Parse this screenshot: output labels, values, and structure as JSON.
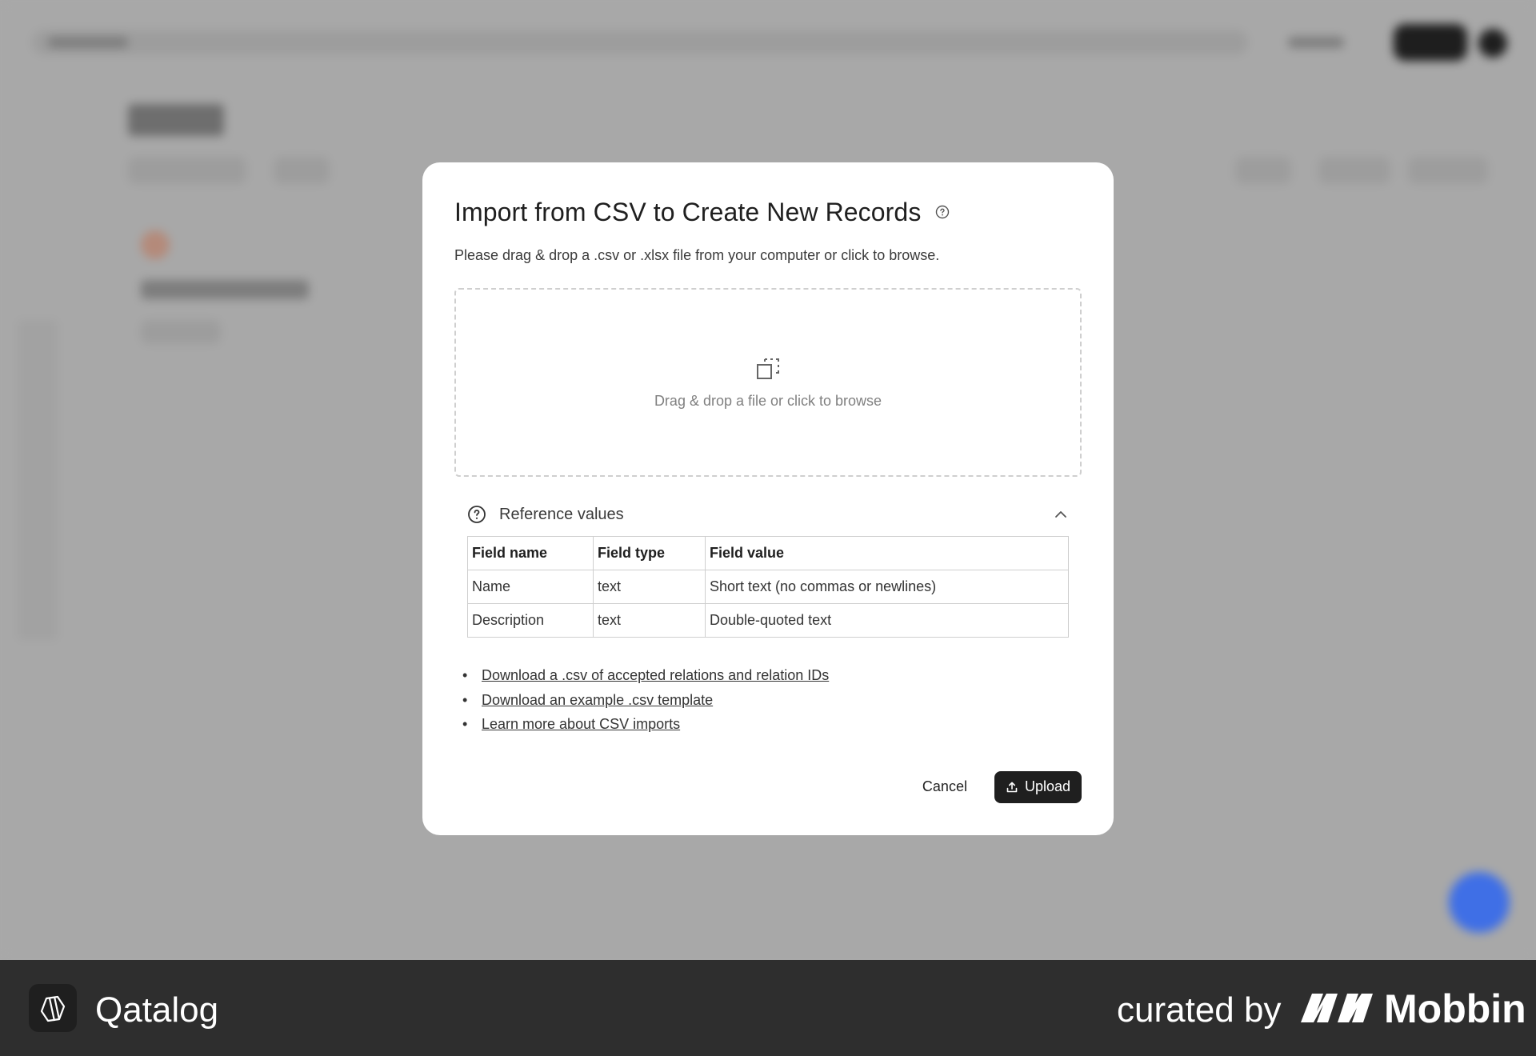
{
  "modal": {
    "title": "Import from CSV to Create New Records",
    "description": "Please drag & drop a .csv or .xlsx file from your computer or click to browse.",
    "dropzone_text": "Drag & drop a file or click to browse",
    "reference": {
      "title": "Reference values",
      "columns": [
        "Field name",
        "Field type",
        "Field value"
      ],
      "rows": [
        [
          "Name",
          "text",
          "Short text (no commas or newlines)"
        ],
        [
          "Description",
          "text",
          "Double-quoted text"
        ]
      ]
    },
    "links": [
      "Download a .csv of accepted relations and relation IDs",
      "Download an example .csv template",
      "Learn more about CSV imports"
    ],
    "cancel_label": "Cancel",
    "upload_label": "Upload"
  },
  "footer": {
    "brand": "Qatalog",
    "curated_by": "curated by",
    "mobbin": "Mobbin"
  }
}
